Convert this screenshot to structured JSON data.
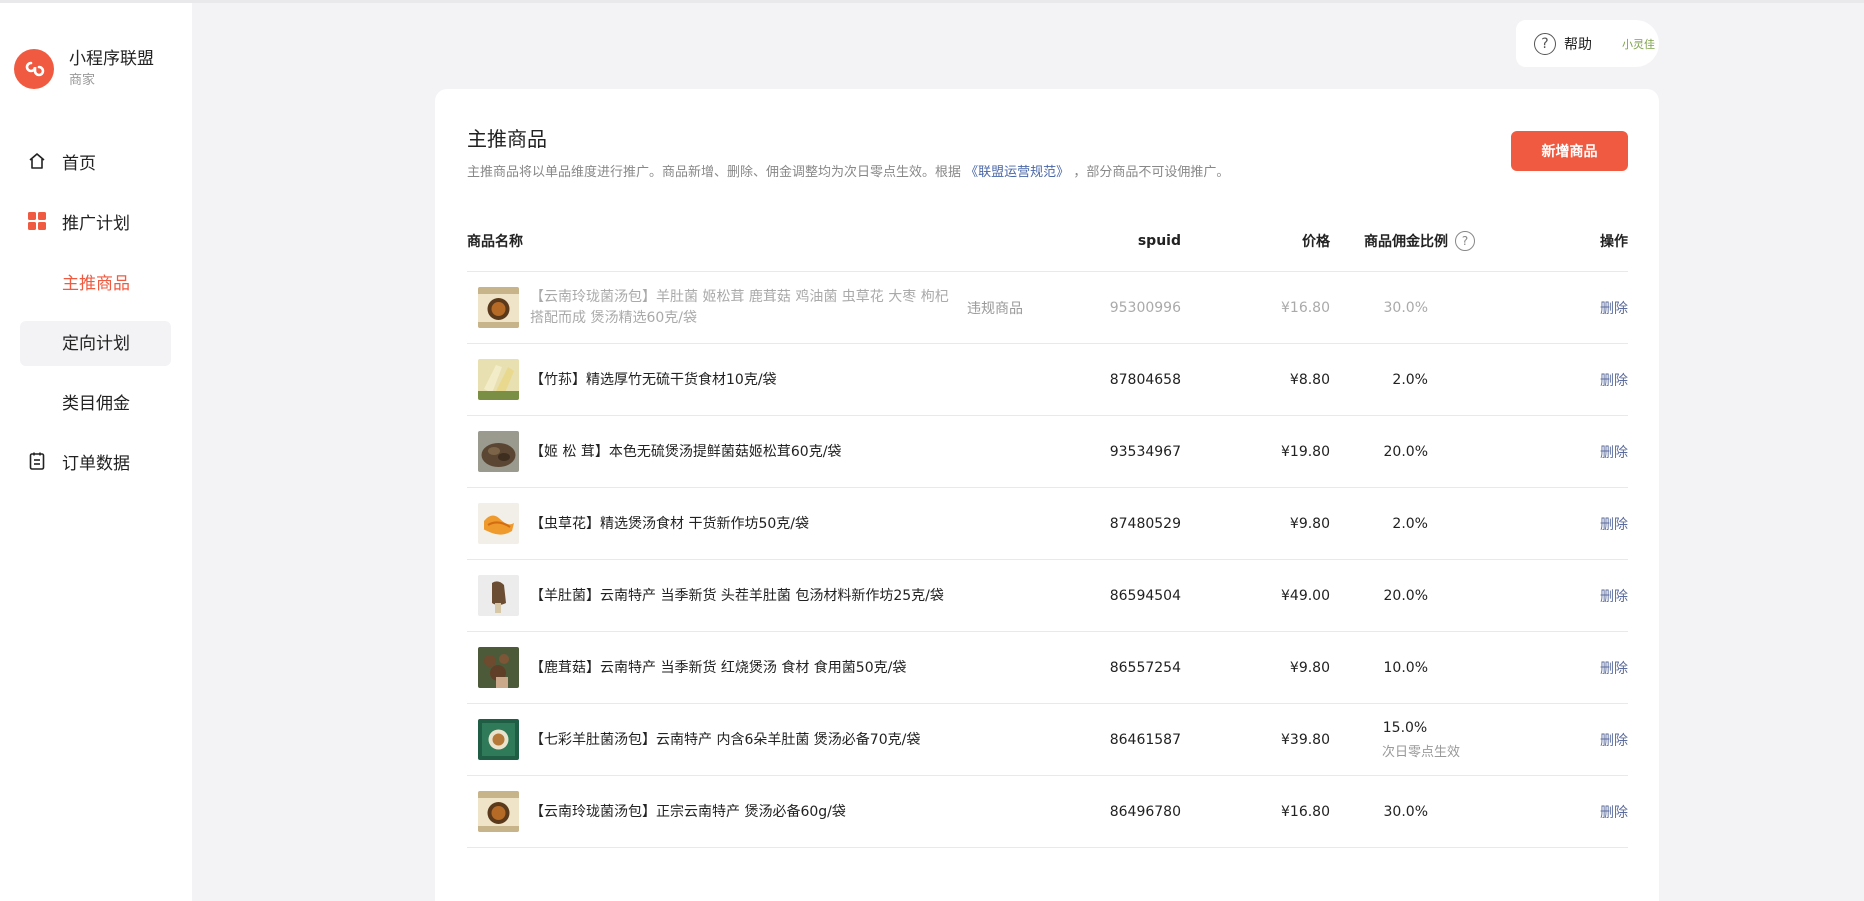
{
  "brand": {
    "title": "小程序联盟",
    "subtitle": "商家",
    "accent": "#f05a40"
  },
  "sidebar": {
    "items": [
      {
        "label": "首页",
        "icon": "home-icon"
      },
      {
        "label": "推广计划",
        "icon": "grid-icon"
      },
      {
        "label": "主推商品",
        "active": true
      },
      {
        "label": "定向计划"
      },
      {
        "label": "类目佣金"
      },
      {
        "label": "订单数据",
        "icon": "clipboard-icon"
      }
    ]
  },
  "header": {
    "help_label": "帮助",
    "user_name": "小灵佳"
  },
  "main": {
    "title": "主推商品",
    "desc_before": "主推商品将以单品维度进行推广。商品新增、删除、佣金调整均为次日零点生效。根据",
    "desc_link": "《联盟运营规范》",
    "desc_after": "，部分商品不可设佣推广。",
    "add_button": "新增商品",
    "columns": {
      "name": "商品名称",
      "spuid": "spuid",
      "price": "价格",
      "rate": "商品佣金比例",
      "op": "操作"
    },
    "rows": [
      {
        "name": "【云南玲珑菌汤包】羊肚菌 姬松茸 鹿茸菇 鸡油菌 虫草花 大枣 枸杞搭配而成 煲汤精选60克/袋",
        "flag": "违规商品",
        "spuid": "95300996",
        "price": "¥16.80",
        "rate": "30.0%",
        "op": "删除"
      },
      {
        "name": "【竹荪】精选厚竹无硫干货食材10克/袋",
        "spuid": "87804658",
        "price": "¥8.80",
        "rate": "2.0%",
        "op": "删除"
      },
      {
        "name": "【姬 松 茸】本色无硫煲汤提鲜菌菇姬松茸60克/袋",
        "spuid": "93534967",
        "price": "¥19.80",
        "rate": "20.0%",
        "op": "删除"
      },
      {
        "name": "【虫草花】精选煲汤食材 干货新作坊50克/袋",
        "spuid": "87480529",
        "price": "¥9.80",
        "rate": "2.0%",
        "op": "删除"
      },
      {
        "name": "【羊肚菌】云南特产 当季新货 头茬羊肚菌 包汤材料新作坊25克/袋",
        "spuid": "86594504",
        "price": "¥49.00",
        "rate": "20.0%",
        "op": "删除"
      },
      {
        "name": "【鹿茸菇】云南特产 当季新货 红烧煲汤 食材 食用菌50克/袋",
        "spuid": "86557254",
        "price": "¥9.80",
        "rate": "10.0%",
        "op": "删除"
      },
      {
        "name": "【七彩羊肚菌汤包】云南特产 内含6朵羊肚菌 煲汤必备70克/袋",
        "spuid": "86461587",
        "price": "¥39.80",
        "rate": "15.0%",
        "rate_note": "次日零点生效",
        "op": "删除"
      },
      {
        "name": "【云南玲珑菌汤包】正宗云南特产 煲汤必备60g/袋",
        "spuid": "86496780",
        "price": "¥16.80",
        "rate": "30.0%",
        "op": "删除"
      }
    ]
  }
}
